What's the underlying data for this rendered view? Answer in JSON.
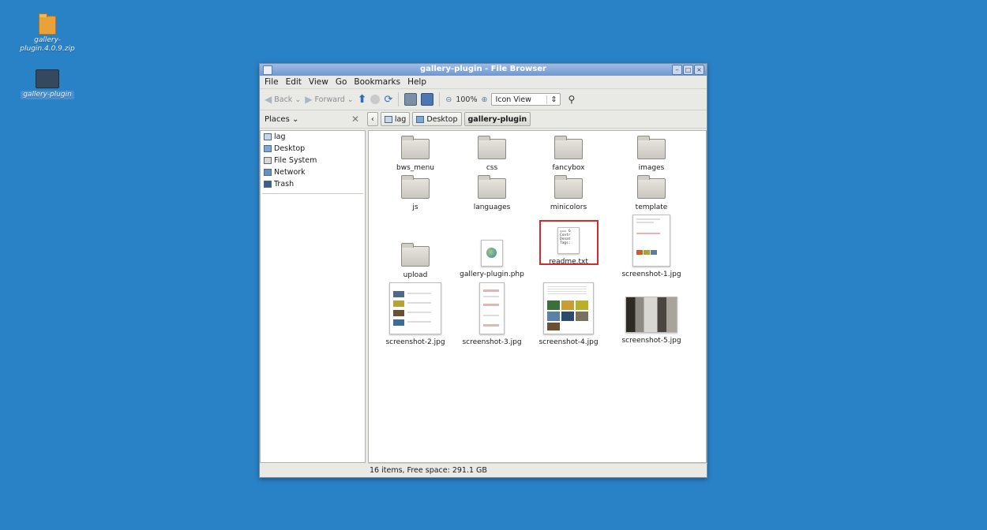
{
  "desktop": {
    "icons": [
      {
        "label": "gallery-plugin.4.0.9.zip"
      },
      {
        "label": "gallery-plugin"
      }
    ]
  },
  "window": {
    "title": "gallery-plugin - File Browser",
    "menu": [
      "File",
      "Edit",
      "View",
      "Go",
      "Bookmarks",
      "Help"
    ],
    "toolbar": {
      "back": "Back",
      "forward": "Forward",
      "zoom": "100%",
      "view_mode": "Icon View"
    },
    "places_header": "Places",
    "breadcrumbs": [
      "lag",
      "Desktop",
      "gallery-plugin"
    ],
    "places": [
      "lag",
      "Desktop",
      "File System",
      "Network",
      "Trash"
    ],
    "items": [
      {
        "name": "bws_menu",
        "type": "folder"
      },
      {
        "name": "css",
        "type": "folder"
      },
      {
        "name": "fancybox",
        "type": "folder"
      },
      {
        "name": "images",
        "type": "folder"
      },
      {
        "name": "js",
        "type": "folder"
      },
      {
        "name": "languages",
        "type": "folder"
      },
      {
        "name": "minicolors",
        "type": "folder"
      },
      {
        "name": "template",
        "type": "folder"
      },
      {
        "name": "upload",
        "type": "folder"
      },
      {
        "name": "gallery-plugin.php",
        "type": "php"
      },
      {
        "name": "readme.txt",
        "type": "text",
        "preview": "=== G\nContr\nDonat\nTags:"
      },
      {
        "name": "screenshot-1.jpg",
        "type": "image"
      },
      {
        "name": "screenshot-2.jpg",
        "type": "image"
      },
      {
        "name": "screenshot-3.jpg",
        "type": "image"
      },
      {
        "name": "screenshot-4.jpg",
        "type": "image"
      },
      {
        "name": "screenshot-5.jpg",
        "type": "image"
      }
    ],
    "status": "16 items, Free space: 291.1 GB"
  },
  "colors": {
    "desktop": "#2a82c6",
    "titlebar": "#7ea5d8",
    "highlight_box": "#d62a2a"
  }
}
